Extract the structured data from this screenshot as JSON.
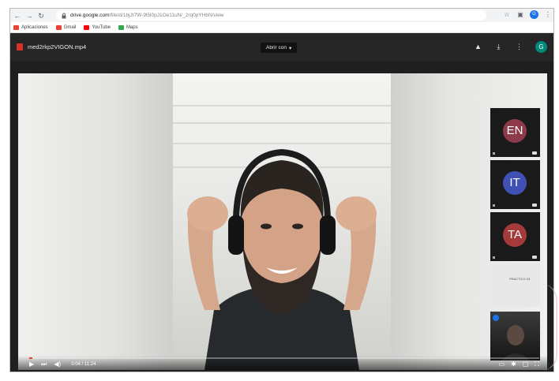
{
  "browser": {
    "url_domain": "drive.google.com",
    "url_rest": "/file/d/1bjJt7W-9l5l0pJ1Oe11uN/_2rq0pYHbN/view"
  },
  "bookmarks": [
    {
      "label": "Aplicaciones",
      "icon": "apps-icon",
      "color": "#ea4335"
    },
    {
      "label": "Gmail",
      "icon": "gmail-icon",
      "color": "#ea4335"
    },
    {
      "label": "YouTube",
      "icon": "youtube-icon",
      "color": "#ff0000"
    },
    {
      "label": "Maps",
      "icon": "maps-icon",
      "color": "#34a853"
    }
  ],
  "drive": {
    "file_name": "med2rkp2VIGON.mp4",
    "open_with_label": "Abrir con",
    "profile_initial": "G"
  },
  "chrome": {
    "profile_initial": "G"
  },
  "participants": [
    {
      "initials": "EN",
      "color": "#8e3a4b"
    },
    {
      "initials": "IT",
      "color": "#3f51b5"
    },
    {
      "initials": "TA",
      "color": "#a53a3a"
    }
  ],
  "whiteboard_text": "PRACTICO 03",
  "player": {
    "time": "0:04 / 11:24",
    "progress": 0.006
  },
  "colors": {
    "accent": "#ea4335",
    "drive_header": "#262626"
  }
}
